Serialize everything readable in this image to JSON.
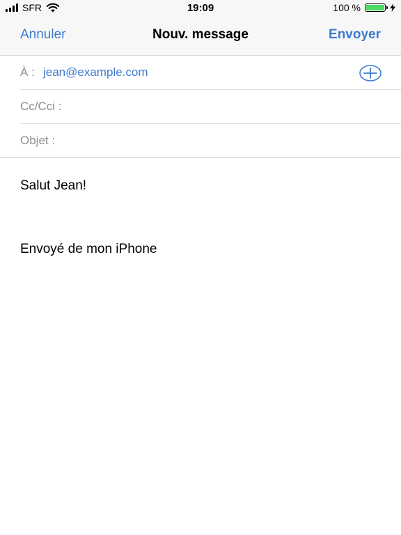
{
  "status_bar": {
    "carrier": "SFR",
    "time": "19:09",
    "battery_percent": "100 %",
    "battery_level": 1.0
  },
  "nav": {
    "cancel_label": "Annuler",
    "title": "Nouv. message",
    "send_label": "Envoyer"
  },
  "fields": {
    "to_label": "À :",
    "to_value": "jean@example.com",
    "cc_label": "Cc/Cci :",
    "subject_label": "Objet :"
  },
  "body": {
    "greeting": "Salut Jean!",
    "signature": "Envoyé de mon iPhone"
  },
  "colors": {
    "accent": "#3c7bd0",
    "label_gray": "#8e8e93",
    "battery_green": "#4cd964"
  },
  "icons": {
    "signal": "cellular-signal-icon",
    "wifi": "wifi-icon",
    "battery": "battery-icon",
    "charging": "charging-bolt-icon",
    "add_contact": "plus-circle-icon"
  }
}
